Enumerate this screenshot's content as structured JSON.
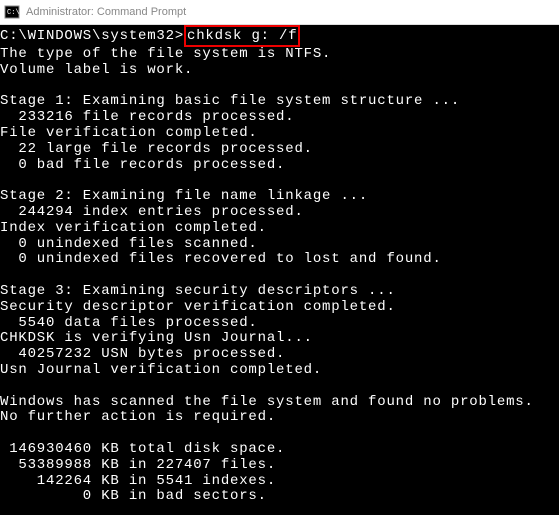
{
  "window": {
    "title": "Administrator: Command Prompt"
  },
  "terminal": {
    "prompt": "C:\\WINDOWS\\system32>",
    "command": "chkdsk g: /f",
    "output": "The type of the file system is NTFS.\nVolume label is work.\n\nStage 1: Examining basic file system structure ...\n  233216 file records processed.\nFile verification completed.\n  22 large file records processed.\n  0 bad file records processed.\n\nStage 2: Examining file name linkage ...\n  244294 index entries processed.\nIndex verification completed.\n  0 unindexed files scanned.\n  0 unindexed files recovered to lost and found.\n\nStage 3: Examining security descriptors ...\nSecurity descriptor verification completed.\n  5540 data files processed.\nCHKDSK is verifying Usn Journal...\n  40257232 USN bytes processed.\nUsn Journal verification completed.\n\nWindows has scanned the file system and found no problems.\nNo further action is required.\n\n 146930460 KB total disk space.\n  53389988 KB in 227407 files.\n    142264 KB in 5541 indexes.\n         0 KB in bad sectors."
  }
}
